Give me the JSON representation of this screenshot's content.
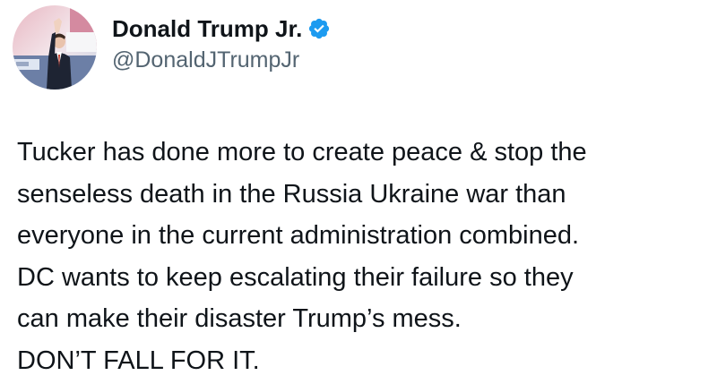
{
  "author": {
    "display_name": "Donald Trump Jr.",
    "handle": "@DonaldJTrumpJr",
    "verified_icon": "verified-badge-icon",
    "avatar_icon": "profile-avatar",
    "verified_color": "#1d9bf0"
  },
  "tweet": {
    "lines": [
      "Tucker has done more to create peace & stop the",
      "senseless death in the Russia Ukraine war than",
      "everyone in the current administration combined.",
      "DC wants to keep escalating their failure so they",
      "can make their disaster Trump’s mess.",
      "DON’T FALL FOR IT."
    ]
  },
  "colors": {
    "text": "#0f1419",
    "secondary_text": "#536471",
    "background": "#ffffff"
  }
}
